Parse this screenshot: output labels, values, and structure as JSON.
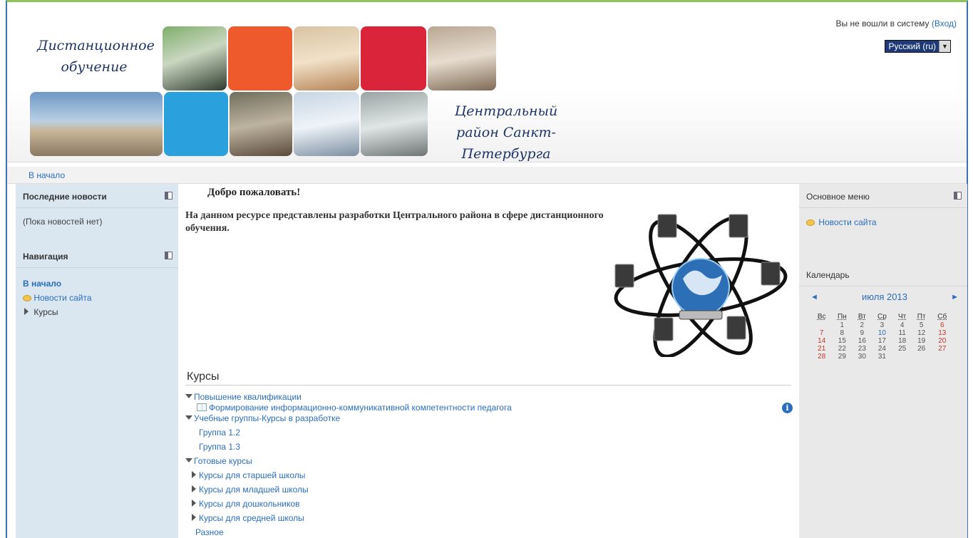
{
  "header": {
    "banner_title_left": "Дистанционное обучение",
    "banner_title_right": "Центральный район Санкт-Петербурга",
    "login_text": "Вы не вошли в систему",
    "login_link": "(Вход)",
    "language": "Русский (ru)"
  },
  "navbar": {
    "breadcrumb": "В начало"
  },
  "left": {
    "news_title": "Последние новости",
    "news_empty": "(Пока новостей нет)",
    "nav_title": "Навигация",
    "nav_home": "В начало",
    "nav_site_news": "Новости сайта",
    "nav_courses": "Курсы"
  },
  "main": {
    "welcome": "Добро пожаловать!",
    "intro": "На данном ресурсе представлены разработки Центрального района в сфере дистанционного обучения.",
    "courses_title": "Курсы",
    "cat_qualification": "Повышение квалификации",
    "course_1": "Формирование информационно-коммуникативной компетентности педагога",
    "cat_groups": "Учебные группы-Курсы в разработке",
    "group_1": "Группа 1.2",
    "group_2": "Группа 1.3",
    "cat_ready": "Готовые курсы",
    "sub_1": "Курсы для старшей школы",
    "sub_2": "Курсы для младшей школы",
    "sub_3": "Курсы для дошкольников",
    "sub_4": "Курсы для средней школы",
    "cat_misc": "Разное"
  },
  "right": {
    "menu_title": "Основное меню",
    "menu_site_news": "Новости сайта",
    "calendar_title": "Календарь",
    "calendar_month": "июля 2013",
    "prev": "◄",
    "next": "►",
    "weekdays": [
      "Вс",
      "Пн",
      "Вт",
      "Ср",
      "Чт",
      "Пт",
      "Сб"
    ],
    "weeks": [
      [
        "",
        "1",
        "2",
        "3",
        "4",
        "5",
        "6"
      ],
      [
        "7",
        "8",
        "9",
        "10",
        "11",
        "12",
        "13"
      ],
      [
        "14",
        "15",
        "16",
        "17",
        "18",
        "19",
        "20"
      ],
      [
        "21",
        "22",
        "23",
        "24",
        "25",
        "26",
        "27"
      ],
      [
        "28",
        "29",
        "30",
        "31",
        "",
        "",
        ""
      ]
    ],
    "today": "10"
  },
  "colors": {
    "link": "#2a6ebb",
    "left_column_bg": "#dbe7f0",
    "right_column_bg": "#e9e9e9",
    "frame_border": "#3d6fb4",
    "top_accent": "#8fc65b"
  }
}
